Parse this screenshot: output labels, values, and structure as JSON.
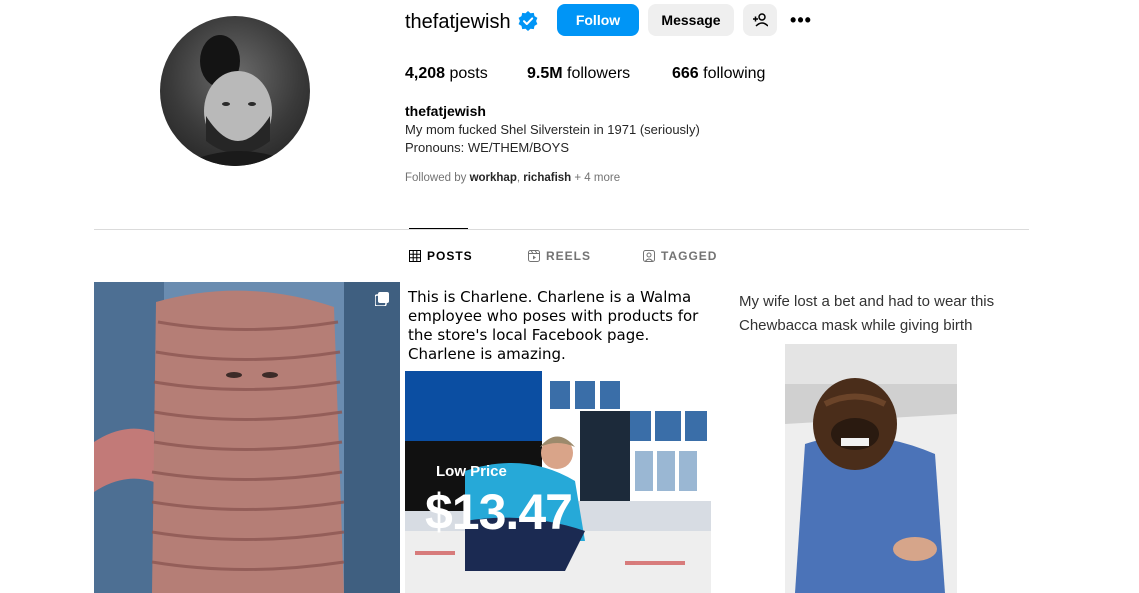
{
  "profile": {
    "username": "thefatjewish",
    "verified": true,
    "buttons": {
      "follow": "Follow",
      "message": "Message"
    },
    "stats": {
      "posts_count": "4,208",
      "posts_label": "posts",
      "followers_count": "9.5M",
      "followers_label": "followers",
      "following_count": "666",
      "following_label": "following"
    },
    "bio": {
      "name": "thefatjewish",
      "line1": "My mom fucked Shel Silverstein in 1971 (seriously)",
      "line2": "Pronouns: WE/THEM/BOYS"
    },
    "followed_by": {
      "prefix": "Followed by ",
      "user1": "workhap",
      "separator": ", ",
      "user2": "richafish",
      "suffix": " + 4 more"
    }
  },
  "tabs": [
    {
      "label": "POSTS",
      "icon": "grid-icon",
      "active": true
    },
    {
      "label": "REELS",
      "icon": "reels-icon",
      "active": false
    },
    {
      "label": "TAGGED",
      "icon": "tagged-icon",
      "active": false
    }
  ],
  "posts": [
    {
      "type": "multi-image",
      "icon": "carousel-icon"
    },
    {
      "caption": "This is Charlene. Charlene is a Walma employee who poses with products for the store's local Facebook page. Charlene is amazing.",
      "price_label": "Low Price",
      "price_value": "$13.47"
    },
    {
      "caption": "My wife lost a bet and had to wear this Chewbacca mask while giving birth"
    }
  ],
  "colors": {
    "accent": "#0095f6",
    "button_bg": "#efefef",
    "muted_text": "#737373",
    "divider": "#dbdbdb"
  }
}
